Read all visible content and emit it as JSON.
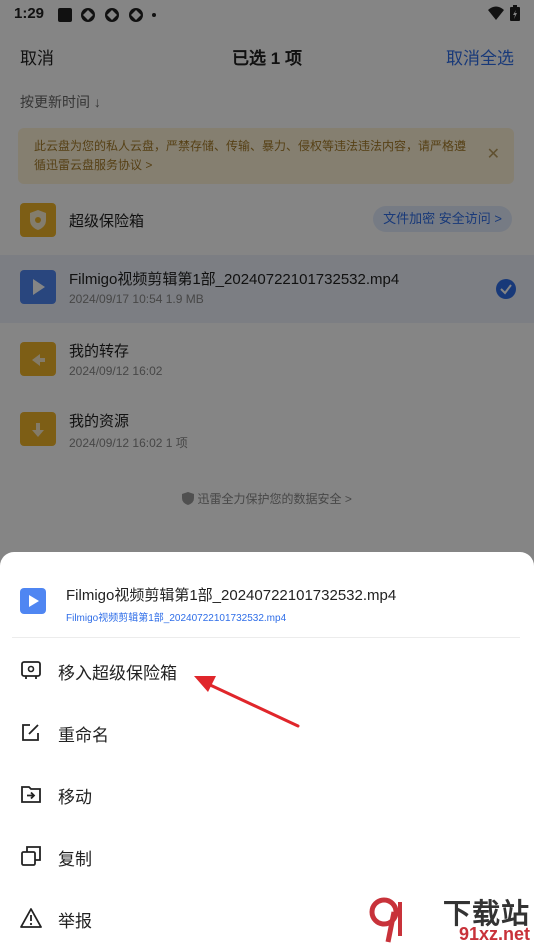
{
  "status": {
    "time": "1:29"
  },
  "header": {
    "cancel": "取消",
    "title": "已选 1 项",
    "deselect_all": "取消全选"
  },
  "sort_label": "按更新时间 ↓",
  "notice": {
    "line1": "此云盘为您的私人云盘，严禁存储、传输、暴力、侵权等违法违法内容，请严格遵",
    "line2": "循迅雷云盘服务协议 >"
  },
  "files": {
    "vault": {
      "name": "超级保险箱",
      "badge": "文件加密 安全访问 >"
    },
    "video": {
      "name": "Filmigo视频剪辑第1部_20240722101732532.mp4",
      "meta": "2024/09/17 10:54  1.9 MB"
    },
    "transfer": {
      "name": "我的转存",
      "meta": "2024/09/12 16:02"
    },
    "resources": {
      "name": "我的资源",
      "meta": "2024/09/12 16:02  1 项"
    }
  },
  "protect_text": "迅雷全力保护您的数据安全 >",
  "sheet": {
    "file_name": "Filmigo视频剪辑第1部_20240722101732532.mp4",
    "file_sub": "Filmigo视频剪辑第1部_20240722101732532.mp4",
    "items": [
      {
        "label": "移入超级保险箱",
        "icon": "vault-icon"
      },
      {
        "label": "重命名",
        "icon": "rename-icon"
      },
      {
        "label": "移动",
        "icon": "move-icon"
      },
      {
        "label": "复制",
        "icon": "copy-icon"
      },
      {
        "label": "举报",
        "icon": "report-icon"
      }
    ]
  },
  "watermark": {
    "top": "下载站",
    "bottom": "91xz.net"
  },
  "colors": {
    "accent": "#2f6ee8",
    "folder": "#f0b429",
    "arrow": "#e0262b"
  }
}
